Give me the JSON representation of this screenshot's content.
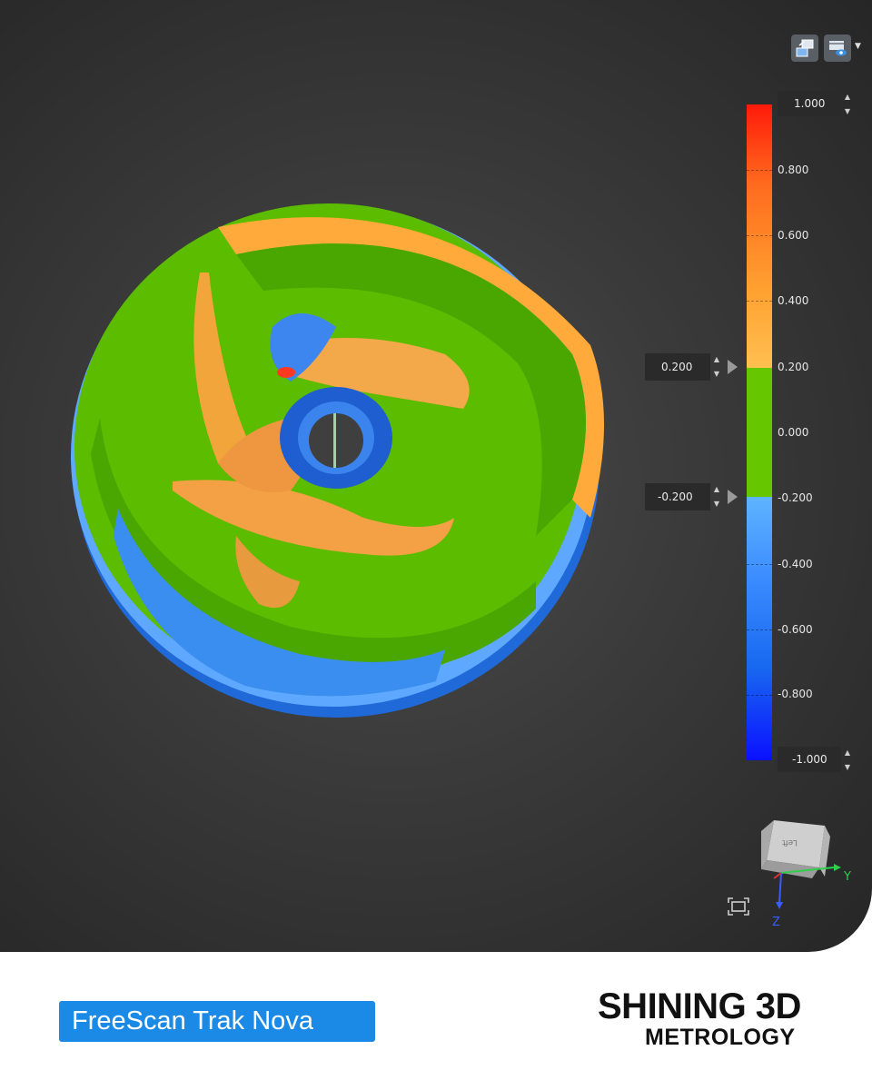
{
  "toolbar": {
    "buttons": [
      {
        "icon": "align-view-icon"
      },
      {
        "icon": "display-mode-icon"
      }
    ],
    "dropdown_icon": "dropdown-caret-icon"
  },
  "color_scale": {
    "max_value": "1.000",
    "min_value": "-1.000",
    "upper_tolerance": "0.200",
    "lower_tolerance": "-0.200",
    "ticks": [
      "1.000",
      "0.800",
      "0.600",
      "0.400",
      "0.200",
      "0.000",
      "-0.200",
      "-0.400",
      "-0.600",
      "-0.800",
      "-1.000"
    ],
    "colors": {
      "high": "#ff2a10",
      "mid_high": "#ff9a2e",
      "in_tolerance": "#66c700",
      "mid_low": "#3c8dff",
      "low": "#1010ff"
    }
  },
  "orientation": {
    "cube_face_label": "Left",
    "axis_y": "Y",
    "axis_z": "Z",
    "fit_view_icon": "fit-view-icon"
  },
  "footer": {
    "product_label": "FreeScan Trak Nova",
    "brand_line1": "SHINING 3D",
    "brand_line2": "METROLOGY"
  }
}
